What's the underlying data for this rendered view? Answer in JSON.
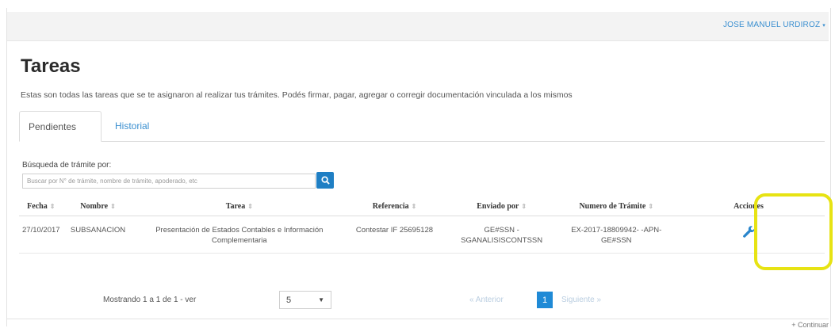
{
  "header": {
    "user_name": "JOSE MANUEL URDIROZ",
    "caret": "▾"
  },
  "page": {
    "title": "Tareas",
    "description": "Estas son todas las tareas que se te asignaron al realizar tus trámites. Podés firmar, pagar, agregar o corregir documentación vinculada a los mismos"
  },
  "tabs": [
    {
      "label": "Pendientes",
      "active": true
    },
    {
      "label": "Historial",
      "active": false
    }
  ],
  "search": {
    "label": "Búsqueda de trámite por:",
    "placeholder": "Buscar por N° de trámite, nombre de trámite, apoderado, etc",
    "button_icon": "search-icon"
  },
  "table": {
    "columns": [
      "Fecha",
      "Nombre",
      "Tarea",
      "Referencia",
      "Enviado por",
      "Numero de Trámite",
      "Acciones"
    ],
    "sort_glyph": "⇕",
    "rows": [
      {
        "fecha": "27/10/2017",
        "nombre": "SUBSANACION",
        "tarea": "Presentación de Estados Contables e Información Complementaria",
        "referencia": "Contestar IF 25695128",
        "enviado_por": "GE#SSN - SGANALISISCONTSSN",
        "numero_tramite": "EX-2017-18809942- -APN-GE#SSN",
        "accion_icon": "wrench-icon"
      }
    ]
  },
  "pagination": {
    "showing": "Mostrando 1 a 1 de 1 - ver",
    "page_size": "5",
    "prev": "« Anterior",
    "current_page": "1",
    "next": "Siguiente »"
  },
  "footer": {
    "continue": "+ Continuar"
  },
  "colors": {
    "accent": "#1f7fc4",
    "highlight": "#e7e313"
  }
}
